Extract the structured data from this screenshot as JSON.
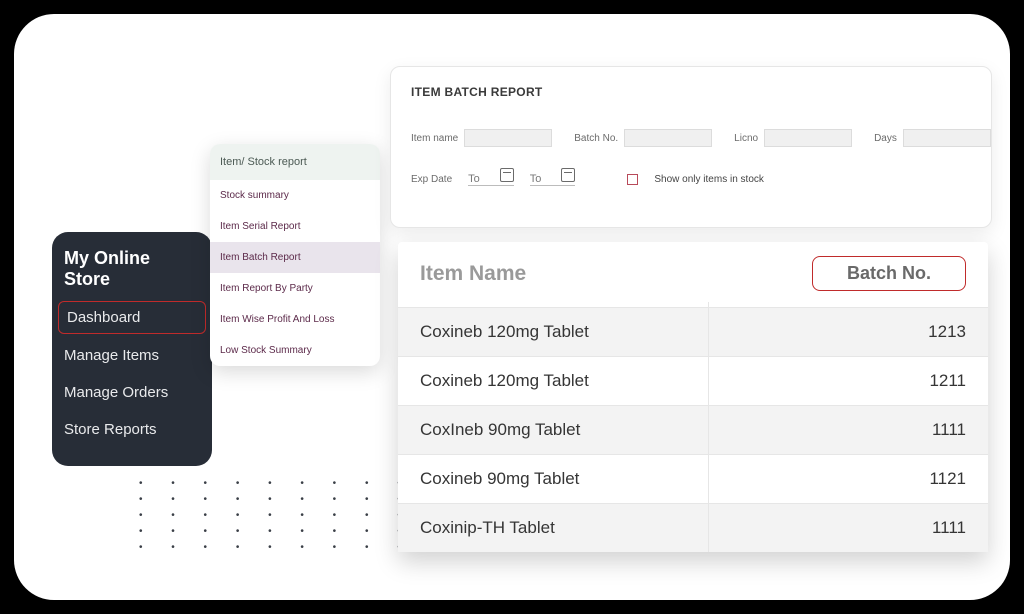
{
  "sidebar": {
    "brand": "My Online Store",
    "items": [
      {
        "label": "Dashboard",
        "active": true
      },
      {
        "label": "Manage Items"
      },
      {
        "label": "Manage Orders"
      },
      {
        "label": "Store Reports"
      }
    ]
  },
  "submenu": {
    "header": "Item/ Stock report",
    "items": [
      {
        "label": "Stock summary"
      },
      {
        "label": "Item Serial Report"
      },
      {
        "label": "Item Batch Report",
        "selected": true
      },
      {
        "label": "Item Report By Party"
      },
      {
        "label": "Item Wise Profit And Loss"
      },
      {
        "label": "Low Stock Summary"
      }
    ]
  },
  "filter": {
    "title": "ITEM BATCH REPORT",
    "item_name_label": "Item name",
    "batch_no_label": "Batch No.",
    "licno_label": "Licno",
    "days_label": "Days",
    "exp_label": "Exp Date",
    "to1": "To",
    "to2": "To",
    "show_only_label": "Show only items in stock"
  },
  "table": {
    "head_item": "Item Name",
    "head_batch": "Batch No.",
    "rows": [
      {
        "name": "Coxineb 120mg Tablet",
        "batch": "1213"
      },
      {
        "name": "Coxineb 120mg Tablet",
        "batch": "1211"
      },
      {
        "name": "CoxIneb 90mg Tablet",
        "batch": "1111"
      },
      {
        "name": "Coxineb 90mg Tablet",
        "batch": "1121"
      },
      {
        "name": "Coxinip-TH Tablet",
        "batch": "1111"
      }
    ]
  }
}
